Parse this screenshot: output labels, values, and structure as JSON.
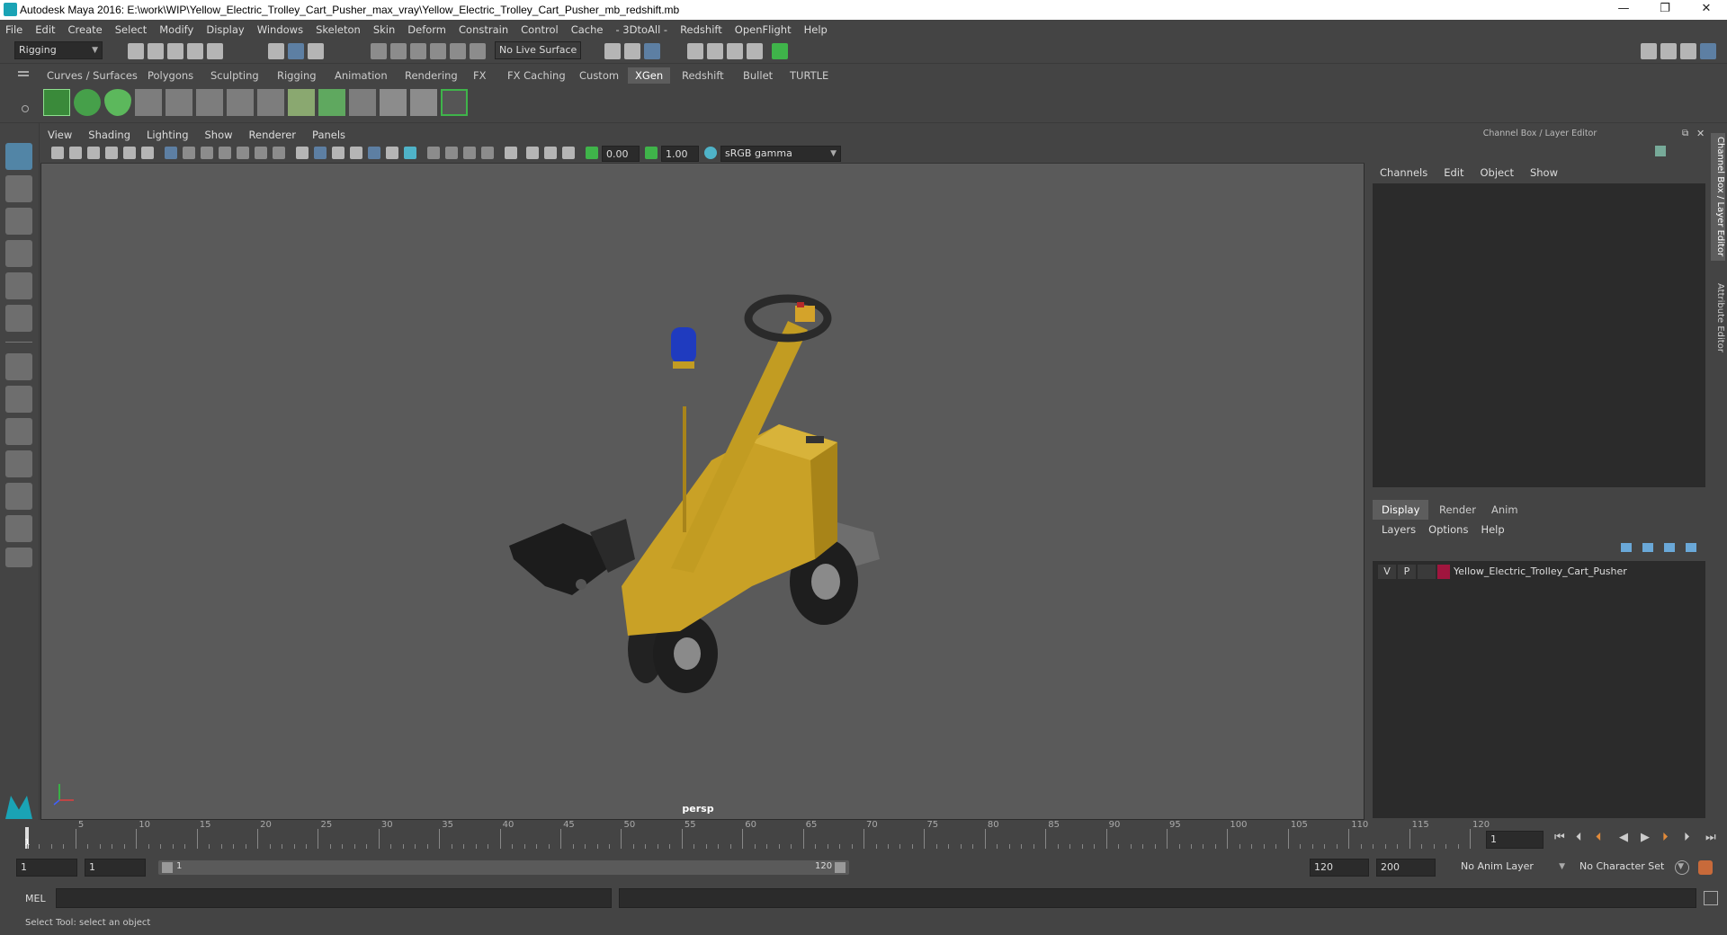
{
  "titlebar": {
    "title": "Autodesk Maya 2016: E:\\work\\WIP\\Yellow_Electric_Trolley_Cart_Pusher_max_vray\\Yellow_Electric_Trolley_Cart_Pusher_mb_redshift.mb",
    "minimize": "—",
    "restore": "❐",
    "close": "✕"
  },
  "menubar": [
    "File",
    "Edit",
    "Create",
    "Select",
    "Modify",
    "Display",
    "Windows",
    "Skeleton",
    "Skin",
    "Deform",
    "Constrain",
    "Control",
    "Cache",
    "- 3DtoAll -",
    "Redshift",
    "OpenFlight",
    "Help"
  ],
  "statusline": {
    "mode": "Rigging",
    "live_surface": "No Live Surface"
  },
  "shelf_tabs": [
    "Curves / Surfaces",
    "Polygons",
    "Sculpting",
    "Rigging",
    "Animation",
    "Rendering",
    "FX",
    "FX Caching",
    "Custom",
    "XGen",
    "Redshift",
    "Bullet",
    "TURTLE"
  ],
  "shelf_active_tab": "XGen",
  "viewport": {
    "menu": [
      "View",
      "Shading",
      "Lighting",
      "Show",
      "Renderer",
      "Panels"
    ],
    "exposure": "0.00",
    "gamma": "1.00",
    "color_space": "sRGB gamma",
    "camera": "persp"
  },
  "channel_box": {
    "title": "Channel Box / Layer Editor",
    "menu": [
      "Channels",
      "Edit",
      "Object",
      "Show"
    ]
  },
  "layer_editor": {
    "tabs": [
      "Display",
      "Render",
      "Anim"
    ],
    "active_tab": "Display",
    "menu": [
      "Layers",
      "Options",
      "Help"
    ],
    "layers": [
      {
        "visible": "V",
        "playback": "P",
        "color": "#a0153e",
        "name": "Yellow_Electric_Trolley_Cart_Pusher"
      }
    ]
  },
  "side_tabs": [
    "Channel Box / Layer Editor",
    "Attribute Editor"
  ],
  "timeslider": {
    "labels": [
      "5",
      "10",
      "15",
      "20",
      "25",
      "30",
      "35",
      "40",
      "45",
      "50",
      "55",
      "60",
      "65",
      "70",
      "75",
      "80",
      "85",
      "90",
      "95",
      "100",
      "105",
      "110",
      "115",
      "120"
    ],
    "start_label": "1",
    "current_frame": "1"
  },
  "rangeslider": {
    "start": "1",
    "playback_start": "1",
    "range_start_label": "1",
    "range_end_label": "120",
    "playback_end": "120",
    "end": "200",
    "anim_layer": "No Anim Layer",
    "character_set": "No Character Set"
  },
  "cmdline": {
    "label": "MEL"
  },
  "helpline": {
    "text": "Select Tool: select an object"
  }
}
